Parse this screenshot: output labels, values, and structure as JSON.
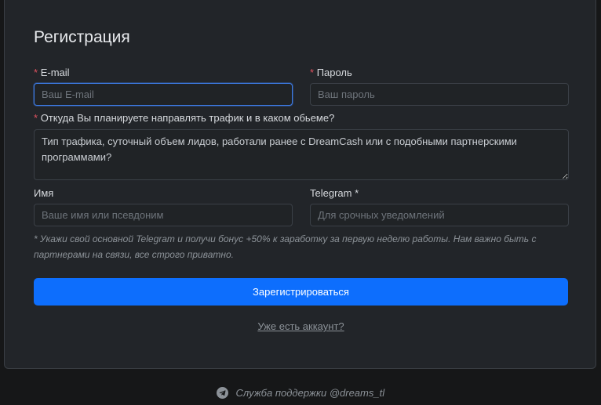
{
  "form": {
    "title": "Регистрация",
    "required_mark": "*",
    "email": {
      "label": "E-mail",
      "placeholder": "Ваш E-mail",
      "value": ""
    },
    "password": {
      "label": "Пароль",
      "placeholder": "Ваш пароль",
      "value": ""
    },
    "traffic": {
      "label": "Откуда Вы планируете направлять трафик и в каком обьеме?",
      "placeholder": "Тип трафика, суточный объем лидов, работали ранее с DreamCash или с подобными партнерскими программами?"
    },
    "name": {
      "label": "Имя",
      "placeholder": "Ваше имя или псевдоним",
      "value": ""
    },
    "telegram": {
      "label": "Telegram *",
      "placeholder": "Для срочных уведомлений",
      "value": ""
    },
    "note": "* Укажи свой основной Telegram и получи бонус +50% к заработку за первую неделю работы. Нам важно быть с партнерами на связи, все строго приватно.",
    "submit_label": "Зарегистрироваться",
    "login_link": "Уже есть аккаунт?"
  },
  "footer": {
    "support_text": "Служба поддержки @dreams_tl",
    "icon": "telegram-icon"
  },
  "colors": {
    "accent": "#0d6efd",
    "required": "#e05260",
    "background": "#161718",
    "card": "#222529"
  }
}
